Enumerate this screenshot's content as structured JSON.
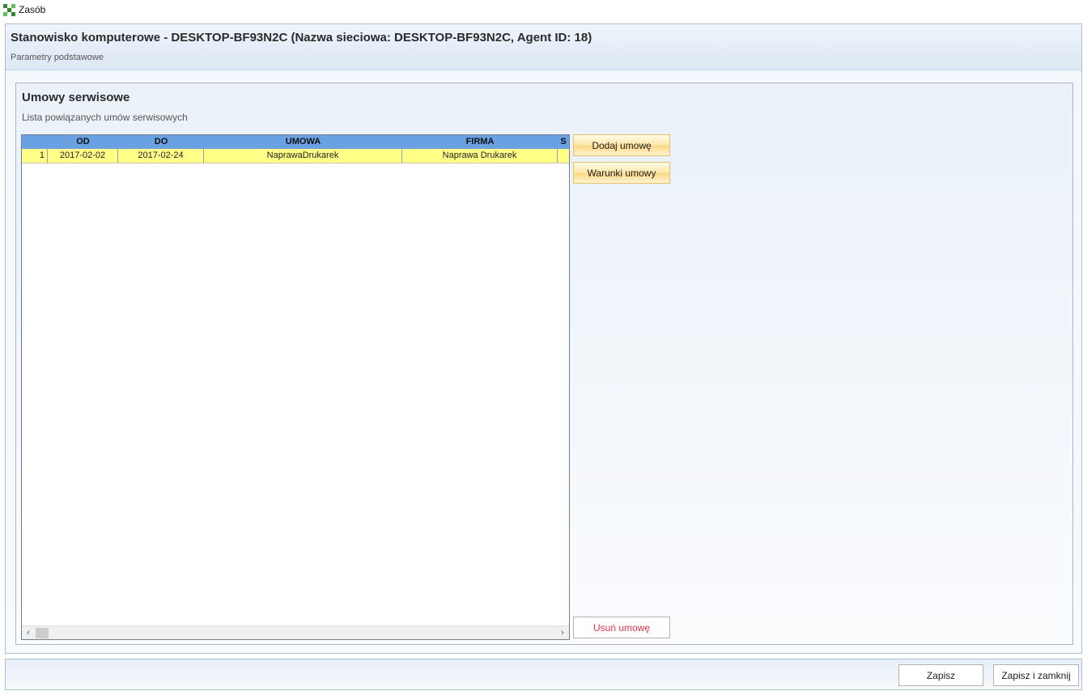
{
  "window": {
    "title": "Zasób",
    "icon": "app-checker-icon",
    "icon_colors": [
      "#2f8a2f",
      "#5fbf5f",
      "#ffffff"
    ]
  },
  "header": {
    "title": "Stanowisko komputerowe - DESKTOP-BF93N2C (Nazwa sieciowa: DESKTOP-BF93N2C, Agent ID: 18)",
    "subtitle": "Parametry podstawowe"
  },
  "section": {
    "title": "Umowy serwisowe",
    "subtitle": "Lista powiązanych umów serwisowych"
  },
  "grid": {
    "columns": [
      "",
      "OD",
      "DO",
      "UMOWA",
      "FIRMA",
      "S"
    ],
    "rows": [
      {
        "num": "1",
        "od": "2017-02-02",
        "do": "2017-02-24",
        "umowa": "NaprawaDrukarek",
        "firma": "Naprawa Drukarek",
        "s": ""
      }
    ],
    "header_color": "#69a1e2",
    "selected_row_color": "#ffff88",
    "scroll_left": "‹",
    "scroll_right": "›"
  },
  "actions": {
    "add_contract": "Dodaj umowę",
    "contract_terms": "Warunki umowy",
    "remove_contract": "Usuń umowę"
  },
  "footer": {
    "save": "Zapisz",
    "save_close": "Zapisz i zamknij"
  }
}
